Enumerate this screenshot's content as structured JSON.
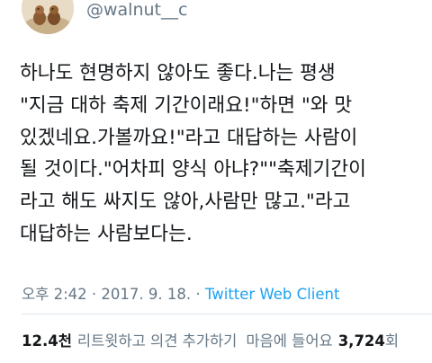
{
  "user": {
    "handle": "@walnut__c",
    "avatar_icon": "profile-photo"
  },
  "tweet": {
    "lines": [
      "하나도 현명하지 않아도 좋다.나는 평생",
      "\"지금 대하 축제 기간이래요!\"하면 \"와 맛",
      "있겠네요.가볼까요!\"라고 대답하는 사람이",
      "될 것이다.\"어차피 양식 아냐?\"\"축제기간이",
      "라고 해도 싸지도 않아,사람만 많고.\"라고",
      "대답하는 사람보다는."
    ]
  },
  "meta": {
    "time": "오후 2:42",
    "separator1": "·",
    "date": "2017. 9. 18.",
    "separator2": "·",
    "source": "Twitter Web Client"
  },
  "stats": {
    "retweets_count": "12.4천",
    "retweets_label": "리트윗하고 의견 추가하기",
    "likes_label": "마음에 들어요",
    "likes_count": "3,724",
    "likes_unit": "회"
  },
  "colors": {
    "text": "#14171a",
    "muted": "#657786",
    "link": "#1da1f2",
    "divider": "#e1e8ed"
  }
}
